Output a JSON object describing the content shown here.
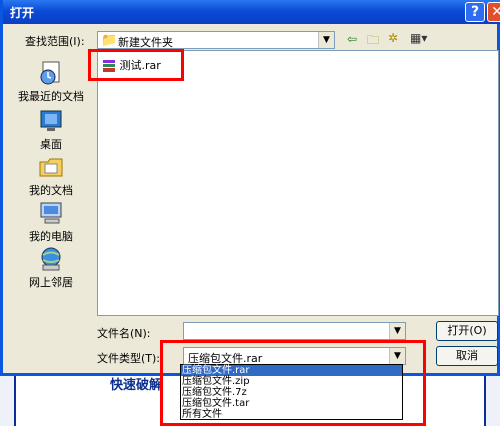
{
  "window": {
    "title": "打开"
  },
  "lookin": {
    "label": "查找范围(I):",
    "value": "新建文件夹"
  },
  "toolbar_icons": [
    "back-arrow-icon",
    "up-folder-icon",
    "new-folder-icon",
    "view-menu-icon"
  ],
  "places": [
    {
      "label": "我最近的文档",
      "icon": "recent-documents-icon"
    },
    {
      "label": "桌面",
      "icon": "desktop-icon"
    },
    {
      "label": "我的文档",
      "icon": "my-documents-icon"
    },
    {
      "label": "我的电脑",
      "icon": "my-computer-icon"
    },
    {
      "label": "网上邻居",
      "icon": "network-places-icon"
    }
  ],
  "files": [
    {
      "name": "测试.rar",
      "icon": "rar-archive-icon"
    }
  ],
  "filename": {
    "label": "文件名(N):",
    "value": ""
  },
  "filetype": {
    "label": "文件类型(T):",
    "value": "压缩包文件.rar",
    "options": [
      "压缩包文件.rar",
      "压缩包文件.zip",
      "压缩包文件.7z",
      "压缩包文件.tar",
      "所有文件"
    ]
  },
  "buttons": {
    "open": "打开(O)",
    "cancel": "取消"
  },
  "background": {
    "text": "快速破解"
  },
  "colors": {
    "highlight": "#ff0000",
    "titlebar": "#0a4cd6",
    "selected": "#316ac5"
  }
}
